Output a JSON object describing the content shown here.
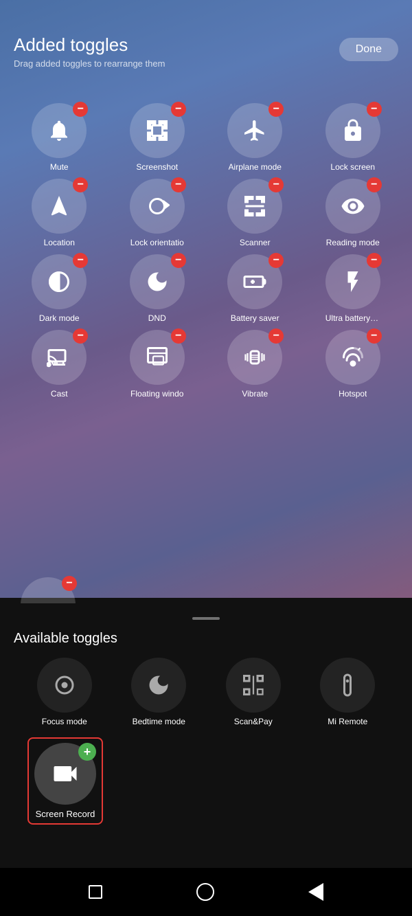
{
  "header": {
    "title": "Added toggles",
    "subtitle": "Drag added toggles to rearrange them",
    "done_label": "Done"
  },
  "added_toggles": [
    {
      "id": "mute",
      "label": "Mute",
      "icon": "bell"
    },
    {
      "id": "screenshot",
      "label": "Screenshot",
      "icon": "screenshot"
    },
    {
      "id": "airplane",
      "label": "Airplane mode",
      "icon": "airplane"
    },
    {
      "id": "lock-screen",
      "label": "Lock screen",
      "icon": "lock"
    },
    {
      "id": "location",
      "label": "Location",
      "icon": "location"
    },
    {
      "id": "lock-orientation",
      "label": "Lock orientatio",
      "icon": "rotate"
    },
    {
      "id": "scanner",
      "label": "Scanner",
      "icon": "scanner"
    },
    {
      "id": "reading-mode",
      "label": "Reading mode",
      "icon": "eye"
    },
    {
      "id": "dark-mode",
      "label": "Dark mode",
      "icon": "dark"
    },
    {
      "id": "dnd",
      "label": "DND",
      "icon": "moon"
    },
    {
      "id": "battery-saver",
      "label": "Battery saver",
      "icon": "battery"
    },
    {
      "id": "ultra-battery",
      "label": "Ultra battery sa",
      "icon": "bolt"
    },
    {
      "id": "cast",
      "label": "Cast",
      "icon": "cast"
    },
    {
      "id": "floating-window",
      "label": "Floating windo",
      "icon": "float"
    },
    {
      "id": "vibrate",
      "label": "Vibrate",
      "icon": "vibrate"
    },
    {
      "id": "hotspot",
      "label": "Hotspot",
      "icon": "hotspot"
    }
  ],
  "available_section": {
    "title": "Available toggles"
  },
  "available_toggles": [
    {
      "id": "focus-mode",
      "label": "Focus mode"
    },
    {
      "id": "bedtime-mode",
      "label": "Bedtime mode"
    },
    {
      "id": "scan-pay",
      "label": "Scan&Pay"
    },
    {
      "id": "mi-remote",
      "label": "Mi Remote"
    }
  ],
  "screen_record": {
    "label": "Screen Record"
  },
  "nav": {
    "square": "■",
    "circle": "○",
    "triangle": "◁"
  }
}
